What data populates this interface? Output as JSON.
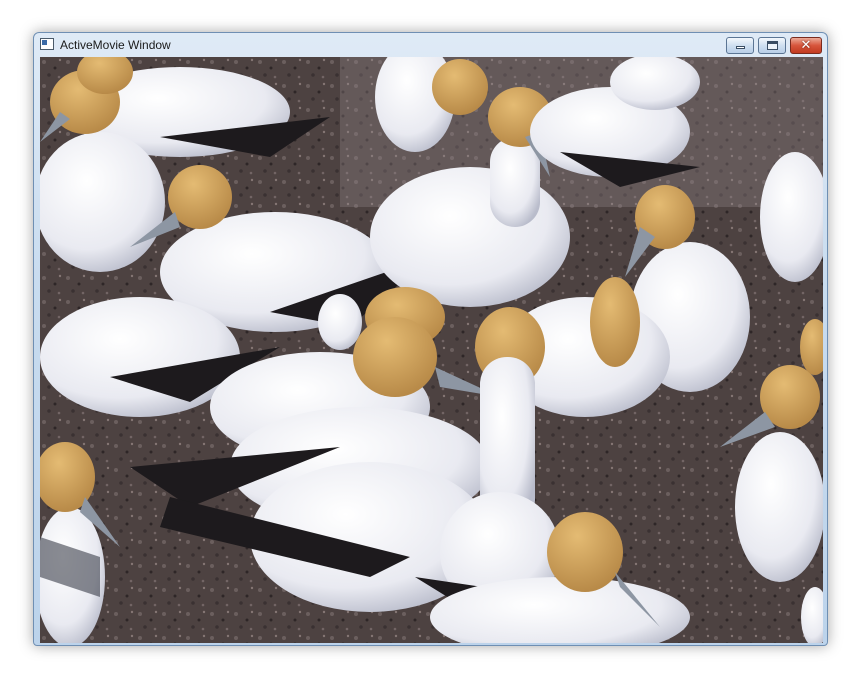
{
  "window": {
    "title": "ActiveMovie Window",
    "icon": "app-icon",
    "controls": {
      "minimize_icon": "minimize-icon",
      "maximize_icon": "maximize-icon",
      "close_icon": "close-icon",
      "close_glyph": "✕"
    }
  },
  "video": {
    "content": "video-frame",
    "colors": {
      "ground": "#4a3f3d",
      "feather": "#f1f2f6",
      "feather_shade": "#c9ccd8",
      "head": "#d4a45a",
      "wingtip": "#1d1a1d",
      "beak": "#8d96a3"
    }
  }
}
